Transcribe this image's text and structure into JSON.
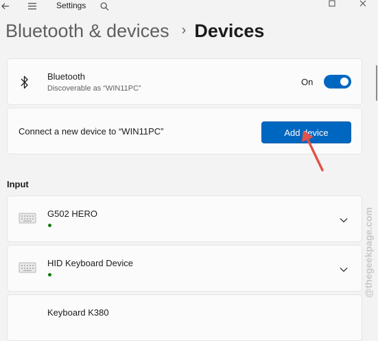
{
  "titlebar": {
    "title": "Settings"
  },
  "breadcrumb": {
    "parent": "Bluetooth & devices",
    "separator": "›",
    "current": "Devices"
  },
  "bluetooth": {
    "title": "Bluetooth",
    "subtitle": "Discoverable as “WIN11PC”",
    "toggle_label": "On",
    "toggle_on": true
  },
  "add_device": {
    "text": "Connect a new device to “WIN11PC”",
    "button_label": "Add device"
  },
  "section": {
    "input_label": "Input"
  },
  "devices": [
    {
      "name": "G502 HERO",
      "status_color": "#0f7b0f"
    },
    {
      "name": "HID Keyboard Device",
      "status_color": "#0f7b0f"
    },
    {
      "name": "Keyboard K380"
    }
  ],
  "colors": {
    "accent": "#0067c0",
    "arrow": "#e0524a"
  },
  "watermark": "@thegeekpage.com"
}
